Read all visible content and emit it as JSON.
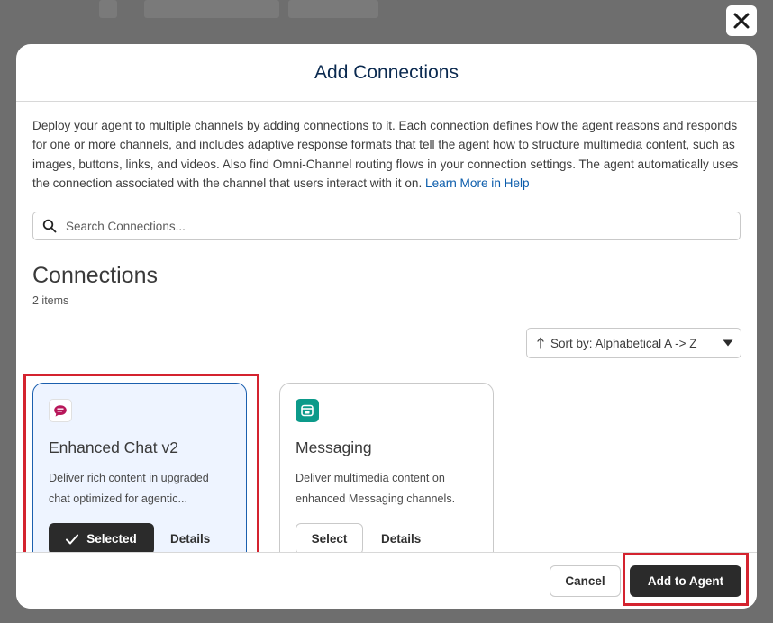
{
  "dialog": {
    "title": "Add Connections",
    "description": "Deploy your agent to multiple channels by adding connections to it. Each connection defines how the agent reasons and responds for one or more channels, and includes adaptive response formats that tell the agent how to structure multimedia content, such as images, buttons, links, and videos. Also find Omni-Channel routing flows in your connection settings. The agent automatically uses the connection associated with the channel that users interact with it on.",
    "learn_more_label": "Learn More in Help",
    "close_icon": "close-icon"
  },
  "search": {
    "placeholder": "Search Connections...",
    "value": "",
    "icon": "search-icon"
  },
  "connections": {
    "heading": "Connections",
    "count_label": "2 items",
    "sort_label": "Sort by: Alphabetical A -> Z"
  },
  "cards": [
    {
      "name": "Enhanced Chat v2",
      "description": "Deliver rich content in upgraded chat optimized for agentic...",
      "primary_label": "Selected",
      "details_label": "Details",
      "selected": true,
      "icon": "chat-bubble-icon",
      "icon_color": "#b8175a"
    },
    {
      "name": "Messaging",
      "description": "Deliver multimedia content on enhanced Messaging channels.",
      "primary_label": "Select",
      "details_label": "Details",
      "selected": false,
      "icon": "messaging-icon",
      "icon_color": "#0c9a8a"
    }
  ],
  "footer": {
    "cancel_label": "Cancel",
    "add_label": "Add to Agent"
  },
  "colors": {
    "accent_border": "#1b5fae",
    "highlight": "#d4232f",
    "primary_button": "#2b2b2b",
    "link": "#0b5cab"
  }
}
